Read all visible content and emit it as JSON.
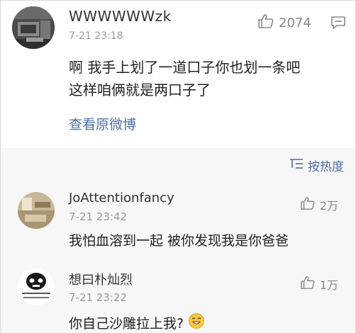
{
  "main_comment": {
    "username": "WWWWWWzk",
    "time": "7-21 23:18",
    "like_count": "2074",
    "content_line1": "啊 我手上划了一道口子你也划一条吧",
    "content_line2": "这样咱俩就是两口子了",
    "view_original_label": "查看原微博"
  },
  "sort": {
    "label": "按热度"
  },
  "replies": [
    {
      "username": "JoAttentionfancy",
      "time": "7-21 23:42",
      "like_count": "2万",
      "text": "我怕血溶到一起 被你发现我是你爸爸"
    },
    {
      "username": "想曰朴灿烈",
      "time": "7-21 23:22",
      "like_count": "1万",
      "text": "你自己沙雕拉上我?"
    }
  ],
  "colors": {
    "link": "#4e6fa6",
    "text": "#222222",
    "muted": "#999999",
    "sub_bg": "#f7f7f7"
  }
}
